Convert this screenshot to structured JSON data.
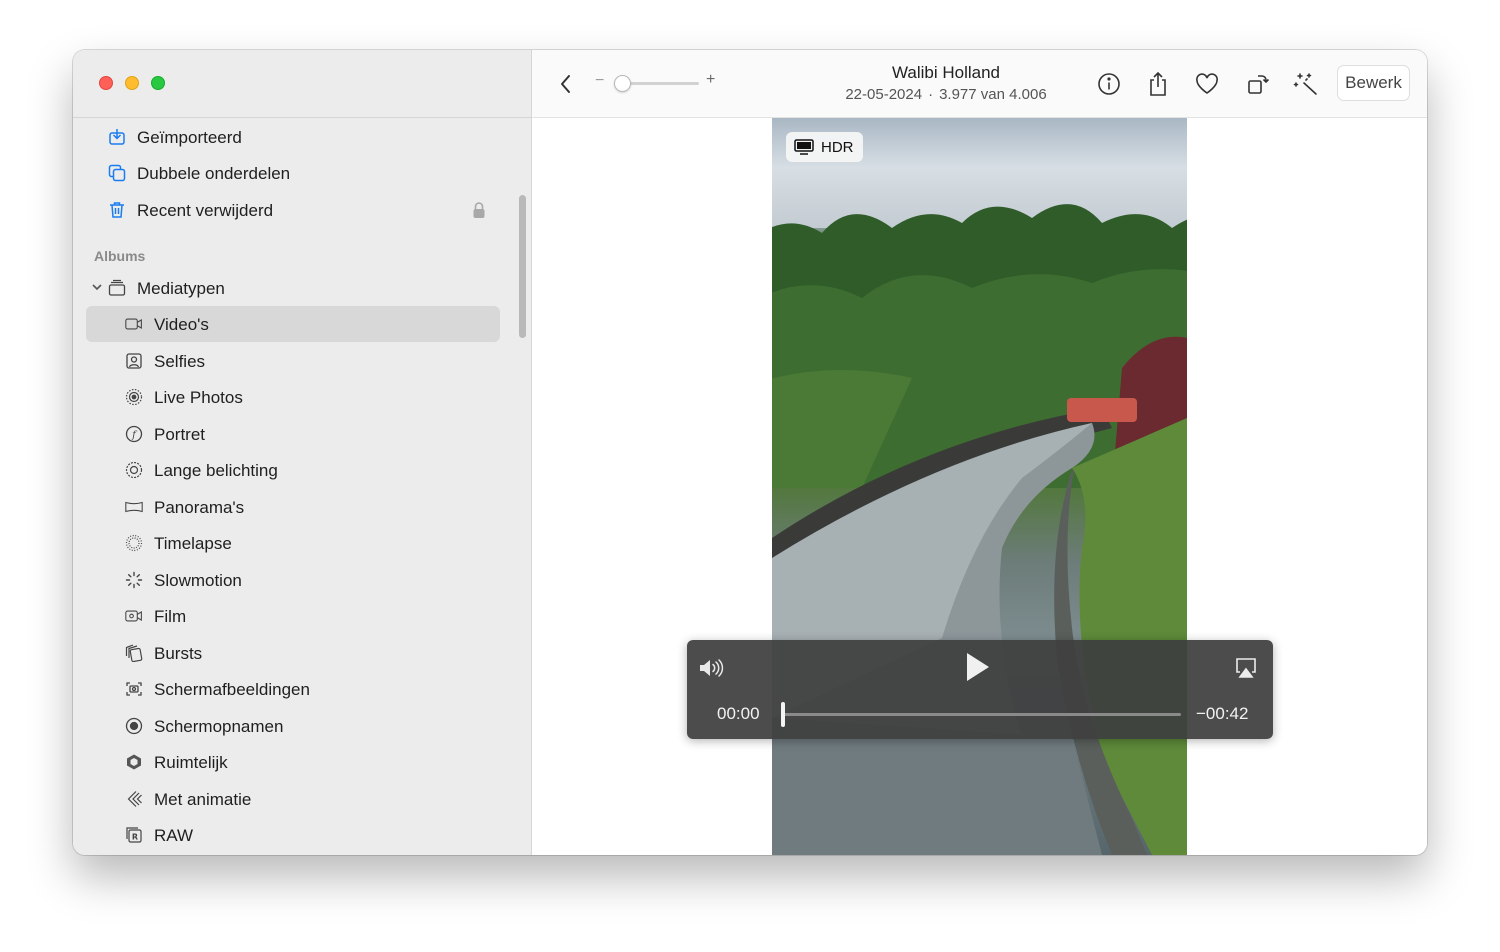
{
  "sidebar": {
    "top_items": [
      {
        "label": "Geïmporteerd",
        "icon": "import-icon"
      },
      {
        "label": "Dubbele onderdelen",
        "icon": "duplicates-icon"
      },
      {
        "label": "Recent verwijderd",
        "icon": "trash-icon",
        "locked": true
      }
    ],
    "albums_title": "Albums",
    "group": {
      "label": "Mediatypen",
      "icon": "media-types-icon",
      "expanded": true
    },
    "media_types": [
      {
        "label": "Video's",
        "icon": "video-icon",
        "selected": true
      },
      {
        "label": "Selfies",
        "icon": "selfie-icon"
      },
      {
        "label": "Live Photos",
        "icon": "live-photo-icon"
      },
      {
        "label": "Portret",
        "icon": "portrait-icon"
      },
      {
        "label": "Lange belichting",
        "icon": "long-exposure-icon"
      },
      {
        "label": "Panorama's",
        "icon": "panorama-icon"
      },
      {
        "label": "Timelapse",
        "icon": "timelapse-icon"
      },
      {
        "label": "Slowmotion",
        "icon": "slowmotion-icon"
      },
      {
        "label": "Film",
        "icon": "film-icon"
      },
      {
        "label": "Bursts",
        "icon": "bursts-icon"
      },
      {
        "label": "Schermafbeeldingen",
        "icon": "screenshot-icon"
      },
      {
        "label": "Schermopnamen",
        "icon": "screen-recording-icon"
      },
      {
        "label": "Ruimtelijk",
        "icon": "spatial-icon"
      },
      {
        "label": "Met animatie",
        "icon": "animated-icon"
      },
      {
        "label": "RAW",
        "icon": "raw-icon"
      }
    ]
  },
  "toolbar": {
    "zoom_minus": "−",
    "zoom_plus": "+",
    "title": "Walibi Holland",
    "date": "22-05-2024",
    "separator": "·",
    "position": "3.977 van 4.006",
    "edit_label": "Bewerk"
  },
  "photo": {
    "badge": "HDR"
  },
  "video": {
    "elapsed": "00:00",
    "remaining": "−00:42",
    "progress": 0.0
  },
  "colors": {
    "sidebar_bg": "#ececec",
    "selected_bg": "#d8d8d8",
    "accent": "#1a7cf0",
    "close": "#fe5f57",
    "minimize": "#febc2e",
    "maximize": "#28c840"
  }
}
